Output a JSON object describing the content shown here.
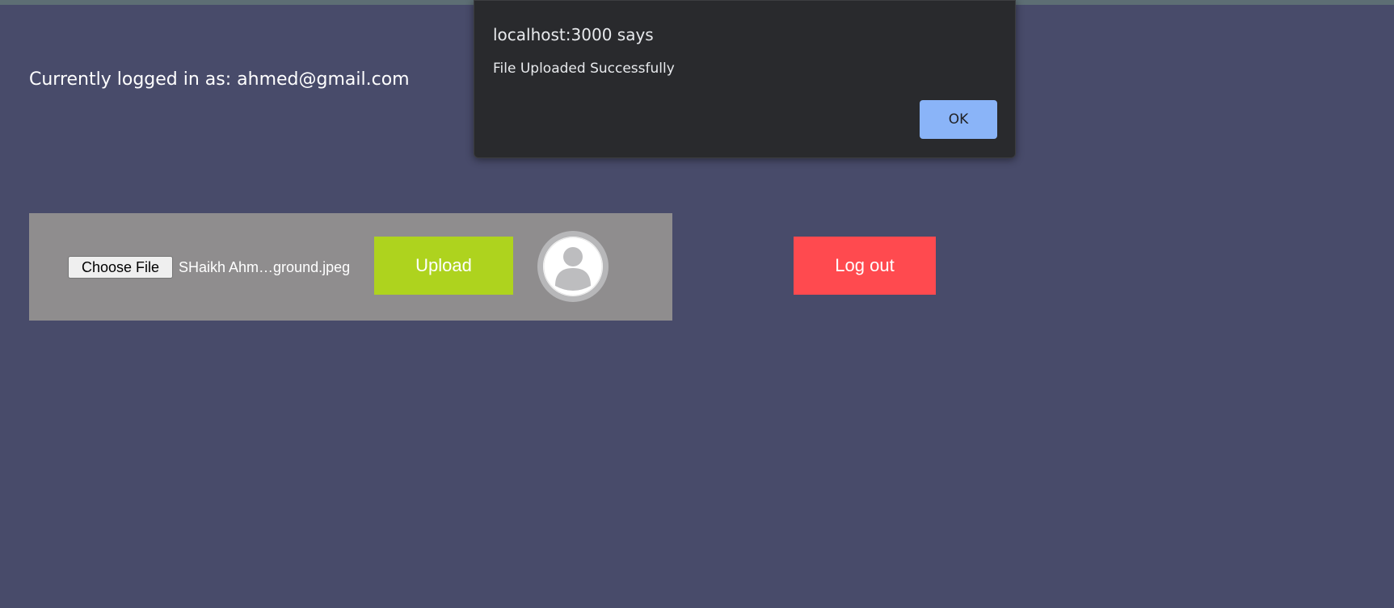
{
  "page": {
    "status_text": "Currently logged in as: ahmed@gmail.com"
  },
  "upload": {
    "choose_file_label": "Choose File",
    "selected_file": "SHaikh Ahm…ground.jpeg",
    "upload_label": "Upload",
    "avatar_icon": "user-avatar-icon"
  },
  "actions": {
    "logout_label": "Log out"
  },
  "dialog": {
    "title": "localhost:3000 says",
    "message": "File Uploaded Successfully",
    "ok_label": "OK"
  },
  "colors": {
    "background": "#484b6a",
    "panel": "#8f8d8e",
    "upload_button": "#aed31e",
    "logout_button": "#ff4a4f",
    "dialog_background": "#292a2d",
    "dialog_ok": "#8ab4f8"
  }
}
